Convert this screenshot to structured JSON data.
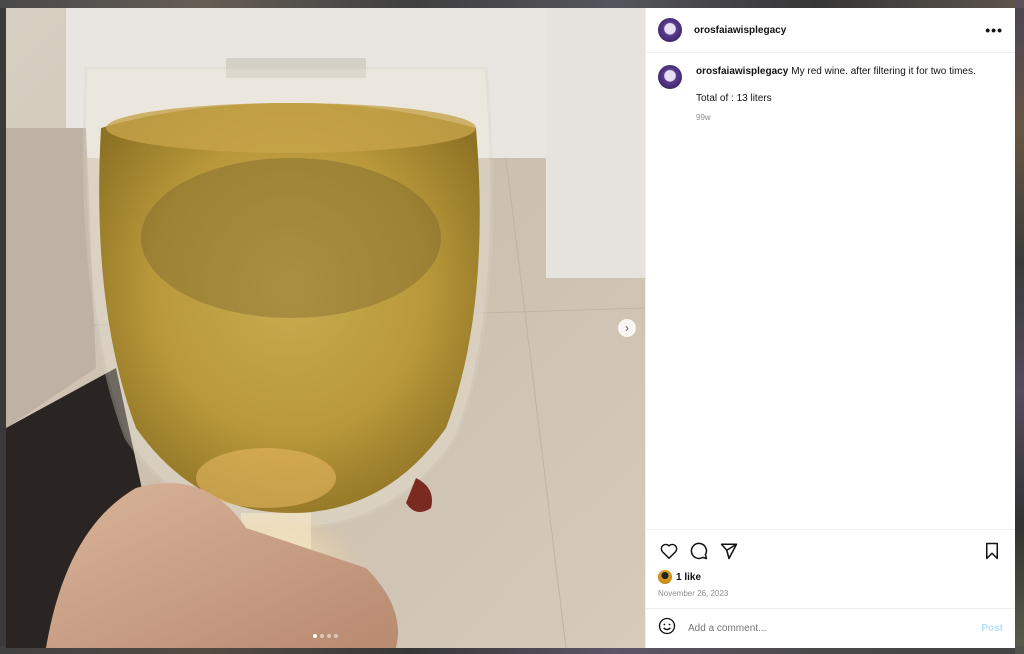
{
  "post": {
    "username": "orosfaiawisplegacy",
    "caption": "My red wine. after filtering it for two times.",
    "caption_line2": "Total of : 13 liters",
    "time_ago": "99w",
    "likes": "1 like",
    "date": "November 26, 2023",
    "carousel": {
      "count": 4,
      "active_index": 0
    }
  },
  "comment_box": {
    "placeholder": "Add a comment...",
    "post_label": "Post"
  },
  "header": {
    "more_label": "•••"
  },
  "icons": {
    "like": "heart-icon",
    "comment": "comment-icon",
    "share": "share-icon",
    "save": "bookmark-icon",
    "emoji": "emoji-icon",
    "next": "chevron-right-icon"
  },
  "colors": {
    "post_button": "#b2dffc",
    "muted_text": "#8e8e8e"
  }
}
